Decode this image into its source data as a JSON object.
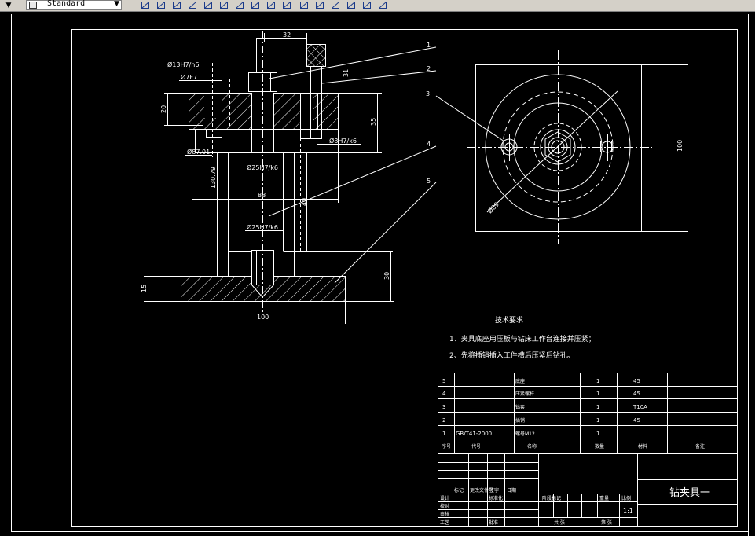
{
  "toolbar": {
    "style_name": "Standard",
    "icons": [
      "pencil-icon",
      "match-properties-icon",
      "mirror-icon",
      "table-icon",
      "grid-icon",
      "move-icon",
      "rotate-icon",
      "scale-icon",
      "stretch-icon",
      "trim-icon",
      "rectangle-icon",
      "rectangle-2-icon",
      "break-icon",
      "fillet-icon",
      "chamfer-icon",
      "explode-icon"
    ]
  },
  "drawing": {
    "dims": {
      "d32": "32",
      "d31": "31",
      "d20": "20",
      "d35": "35",
      "d100v": "100",
      "d30": "30",
      "d15": "15",
      "d100h": "100",
      "d88": "88",
      "d130": "130.79",
      "d40": "40",
      "d89": "Ø89"
    },
    "fits": {
      "f1": "Ø13H7/n6",
      "f2": "Ø7F7",
      "f3": "Ø8H7/k6",
      "f4": "Ø25H7/k6",
      "f5": "Ø25H7/k6",
      "f6": "Ø87.01"
    },
    "leaders": [
      "1",
      "2",
      "3",
      "4",
      "5"
    ],
    "notes": {
      "title": "技术要求",
      "n1": "1、夹具底座用压板与钻床工作台连接并压紧；",
      "n2": "2、先将插销插入工件槽后压紧后钻孔。"
    }
  },
  "bom": {
    "rows": [
      {
        "num": "5",
        "code": "",
        "name": "底座",
        "qty": "1",
        "mat": "45"
      },
      {
        "num": "4",
        "code": "",
        "name": "压紧螺杆",
        "qty": "1",
        "mat": "45"
      },
      {
        "num": "3",
        "code": "",
        "name": "钻套",
        "qty": "1",
        "mat": "T10A"
      },
      {
        "num": "2",
        "code": "",
        "name": "插销",
        "qty": "1",
        "mat": "45"
      },
      {
        "num": "1",
        "code": "GB/T41-2000",
        "name": "螺母M12",
        "qty": "1",
        "mat": ""
      }
    ],
    "header": {
      "num": "序号",
      "code": "代号",
      "name": "名称",
      "qty": "数量",
      "mat": "材料",
      "note": "备注"
    }
  },
  "title_block": {
    "drawing_title": "钻夹具一",
    "scale": "1:1",
    "scale_label": "比例",
    "labels": {
      "marker": "标记",
      "change_doc": "更改文件号",
      "sign": "签字",
      "date": "日期",
      "design": "设计",
      "check": "校对",
      "review": "审核",
      "craft": "工艺",
      "stdz": "标准化",
      "approve": "批准",
      "stage": "阶段标记",
      "weight": "重量",
      "sheet": "共 张",
      "page": "第 张"
    }
  },
  "colors": {
    "bg": "#000000",
    "line": "#ffffff",
    "toolbar": "#d4d0c8"
  }
}
